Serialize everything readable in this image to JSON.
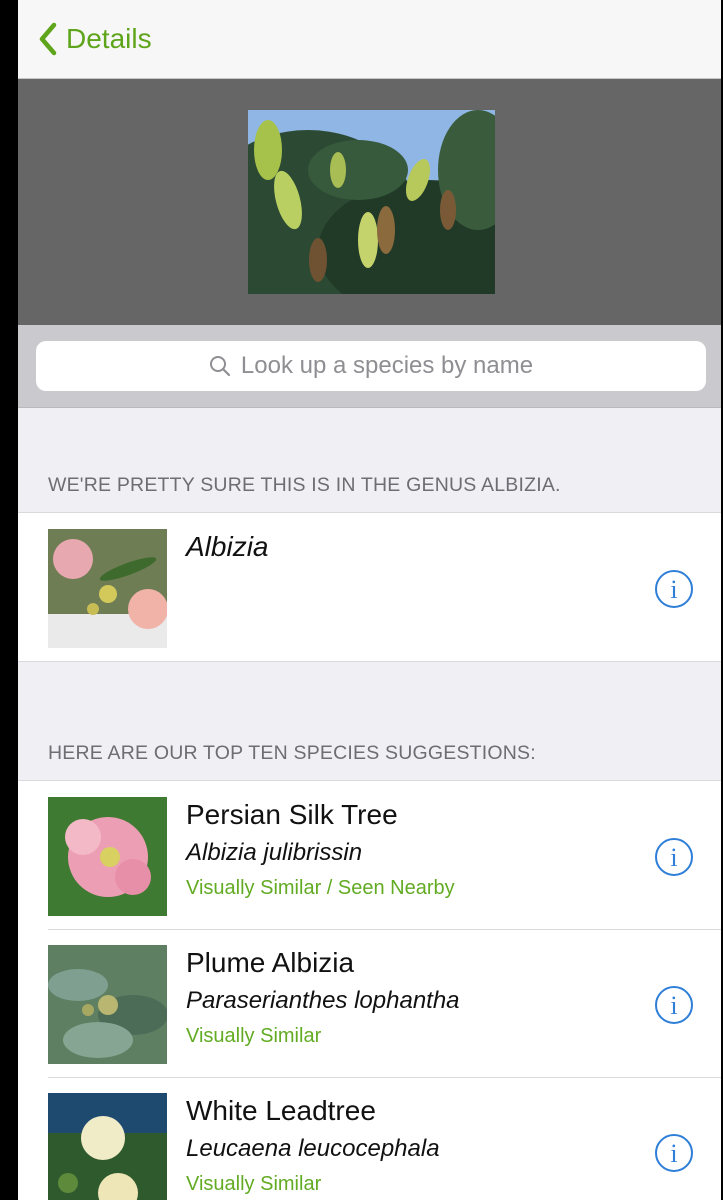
{
  "navbar": {
    "back_label": "Details"
  },
  "search": {
    "placeholder": "Look up a species by name"
  },
  "genus_section": {
    "header": "WE'RE PRETTY SURE THIS IS IN THE GENUS ALBIZIA.",
    "name": "Albizia"
  },
  "species_section": {
    "header": "HERE ARE OUR TOP TEN SPECIES SUGGESTIONS:",
    "items": [
      {
        "common": "Persian Silk Tree",
        "scientific": "Albizia julibrissin",
        "tag": "Visually Similar / Seen Nearby"
      },
      {
        "common": "Plume Albizia",
        "scientific": "Paraserianthes lophantha",
        "tag": "Visually Similar"
      },
      {
        "common": "White Leadtree",
        "scientific": "Leucaena leucocephala",
        "tag": "Visually Similar"
      }
    ]
  },
  "colors": {
    "accent_green": "#5fa51b",
    "info_blue": "#2f7fd8"
  },
  "icons": [
    "chevron-left-icon",
    "search-icon",
    "info-icon"
  ]
}
